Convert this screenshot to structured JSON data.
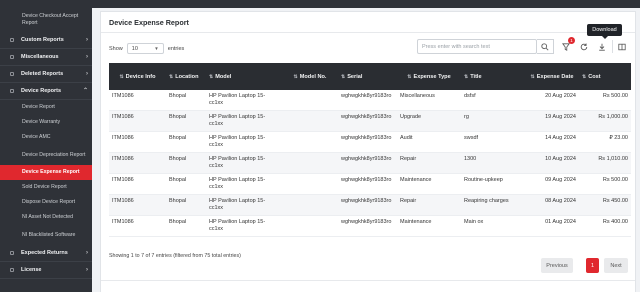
{
  "sidebar": {
    "items": [
      {
        "label": "Device Checkout Accept Report",
        "type": "sub-first"
      },
      {
        "label": "Custom Reports",
        "type": "section"
      },
      {
        "label": "Miscellaneous",
        "type": "section"
      },
      {
        "label": "Deleted Reports",
        "type": "section"
      },
      {
        "label": "Device Reports",
        "type": "section-open"
      },
      {
        "label": "Device Report",
        "type": "sub"
      },
      {
        "label": "Device Warranty",
        "type": "sub"
      },
      {
        "label": "Device AMC",
        "type": "sub"
      },
      {
        "label": "Device Depreciation Report",
        "type": "sub"
      },
      {
        "label": "Device Expense Report",
        "type": "active"
      },
      {
        "label": "Sold Device Report",
        "type": "sub"
      },
      {
        "label": "Dispose Device Report",
        "type": "sub"
      },
      {
        "label": "NI Asset Not Detected",
        "type": "sub"
      },
      {
        "label": "NI Blacklisted Software",
        "type": "sub"
      },
      {
        "label": "Expected Returns",
        "type": "section"
      },
      {
        "label": "License",
        "type": "section"
      }
    ]
  },
  "page": {
    "title": "Device Expense Report",
    "show_label": "Show",
    "entries_value": "10",
    "entries_label": "entries",
    "search_placeholder": "Press enter with search text",
    "filter_badge": "1",
    "tooltip": "Download",
    "info": "Showing 1 to 7 of 7 entries (filtered from 75 total entries)",
    "pagination": {
      "previous": "Previous",
      "current": "1",
      "next": "Next"
    }
  },
  "table": {
    "columns": [
      "Device Info",
      "Location",
      "Model",
      "Model No.",
      "Serial",
      "Expense Type",
      "Title",
      "Expense Date",
      "Cost"
    ],
    "rows": [
      [
        "ITM1086",
        "Bhopal",
        "HP Pavilion Laptop 15-cc1xx",
        "",
        "wghwgkhk8yr9183ro",
        "Miscellaneous",
        "dsfsf",
        "20 Aug 2024",
        "Rs 500.00"
      ],
      [
        "ITM1086",
        "Bhopal",
        "HP Pavilion Laptop 15-cc1xx",
        "",
        "wghwgkhk8yr9183ro",
        "Upgrade",
        "rg",
        "19 Aug 2024",
        "Rs 1,000.00"
      ],
      [
        "ITM1086",
        "Bhopal",
        "HP Pavilion Laptop 15-cc1xx",
        "",
        "wghwgkhk8yr9183ro",
        "Audit",
        "swsdf",
        "14 Aug 2024",
        "₽ 23.00"
      ],
      [
        "ITM1086",
        "Bhopal",
        "HP Pavilion Laptop 15-cc1xx",
        "",
        "wghwgkhk8yr9183ro",
        "Repair",
        "1300",
        "10 Aug 2024",
        "Rs 1,010.00"
      ],
      [
        "ITM1086",
        "Bhopal",
        "HP Pavilion Laptop 15-cc1xx",
        "",
        "wghwgkhk8yr9183ro",
        "Maintenance",
        "Routine-upkeep",
        "09 Aug 2024",
        "Rs 500.00"
      ],
      [
        "ITM1086",
        "Bhopal",
        "HP Pavilion Laptop 15-cc1xx",
        "",
        "wghwgkhk8yr9183ro",
        "Repair",
        "Reapiring charges",
        "08 Aug 2024",
        "Rs 450.00"
      ],
      [
        "ITM1086",
        "Bhopal",
        "HP Pavilion Laptop 15-cc1xx",
        "",
        "wghwgkhk8yr9183ro",
        "Maintenance",
        "Main ox",
        "01 Aug 2024",
        "Rs 400.00"
      ]
    ]
  },
  "colors": {
    "accent": "#e0282e",
    "sidebar": "#2f3238",
    "header": "#2a2d32"
  }
}
